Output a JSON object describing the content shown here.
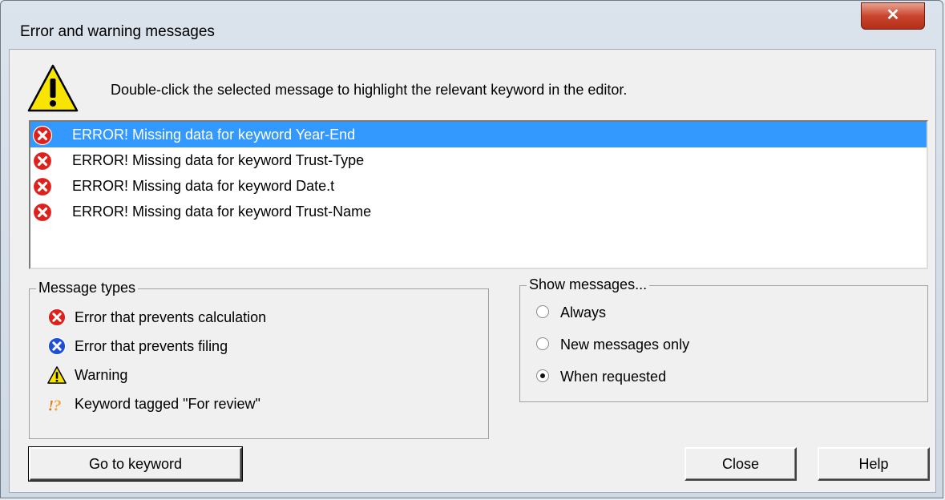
{
  "window": {
    "title": "Error and warning messages",
    "close_glyph": "✕"
  },
  "instruction": "Double-click the selected message to highlight the relevant keyword in the editor.",
  "messages": [
    {
      "text": "ERROR! Missing data for keyword Year-End",
      "icon": "error-red-icon",
      "selected": true
    },
    {
      "text": "ERROR! Missing data for keyword Trust-Type",
      "icon": "error-red-icon",
      "selected": false
    },
    {
      "text": "ERROR! Missing data for keyword Date.t",
      "icon": "error-red-icon",
      "selected": false
    },
    {
      "text": "ERROR! Missing data for keyword Trust-Name",
      "icon": "error-red-icon",
      "selected": false
    }
  ],
  "message_types": {
    "legend": "Message types",
    "items": [
      {
        "label": "Error that prevents calculation",
        "icon": "error-red-icon"
      },
      {
        "label": "Error that prevents filing",
        "icon": "error-blue-icon"
      },
      {
        "label": "Warning",
        "icon": "warning-icon"
      },
      {
        "label": "Keyword tagged \"For review\"",
        "icon": "for-review-icon"
      }
    ]
  },
  "show_messages": {
    "legend": "Show messages...",
    "options": [
      {
        "label": "Always",
        "checked": false
      },
      {
        "label": "New messages only",
        "checked": false
      },
      {
        "label": "When requested",
        "checked": true
      }
    ]
  },
  "buttons": {
    "go_to_keyword": "Go to keyword",
    "close": "Close",
    "help": "Help"
  },
  "colors": {
    "selection": "#3399ff",
    "error_red": "#e0201b",
    "error_blue": "#1e4fd8",
    "warning_yellow": "#f7e400"
  }
}
